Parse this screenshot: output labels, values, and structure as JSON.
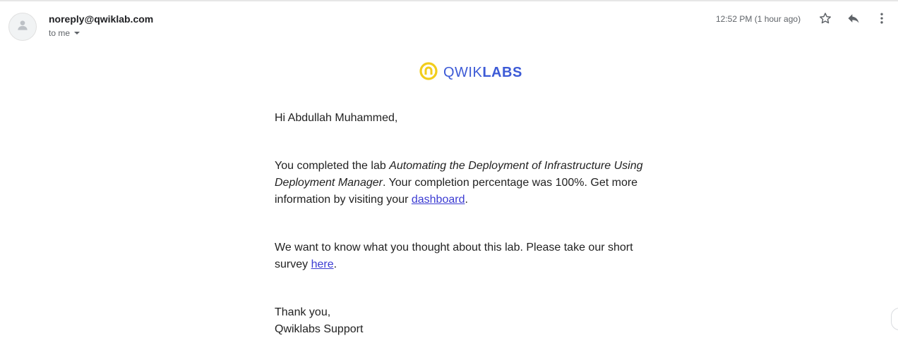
{
  "header": {
    "sender": "noreply@qwiklab.com",
    "recipient_label": "to me",
    "timestamp": "12:52 PM (1 hour ago)",
    "icons": {
      "avatar": "person-icon",
      "star": "star-outline-icon",
      "reply": "reply-icon",
      "more": "more-vert-icon"
    }
  },
  "logo": {
    "word_light": "QWIK",
    "word_bold": "LABS",
    "mark_color": "#f2cd1c",
    "text_color": "#3c5ad6"
  },
  "message": {
    "greeting": "Hi Abdullah Muhammed,",
    "p1_prefix": "You completed the lab ",
    "lab_name": "Automating the Deployment of Infrastructure Using Deployment Manager",
    "p1_middle": ". Your completion percentage was 100%. Get more information by visiting your ",
    "dashboard_link": "dashboard",
    "p1_suffix": ".",
    "p2_prefix": "We want to know what you thought about this lab. Please take our short survey ",
    "survey_link": "here",
    "p2_suffix": ".",
    "closing": "Thank you,",
    "signature": "Qwiklabs Support"
  },
  "colors": {
    "link": "#3b3bd2",
    "muted": "#5f6368"
  }
}
